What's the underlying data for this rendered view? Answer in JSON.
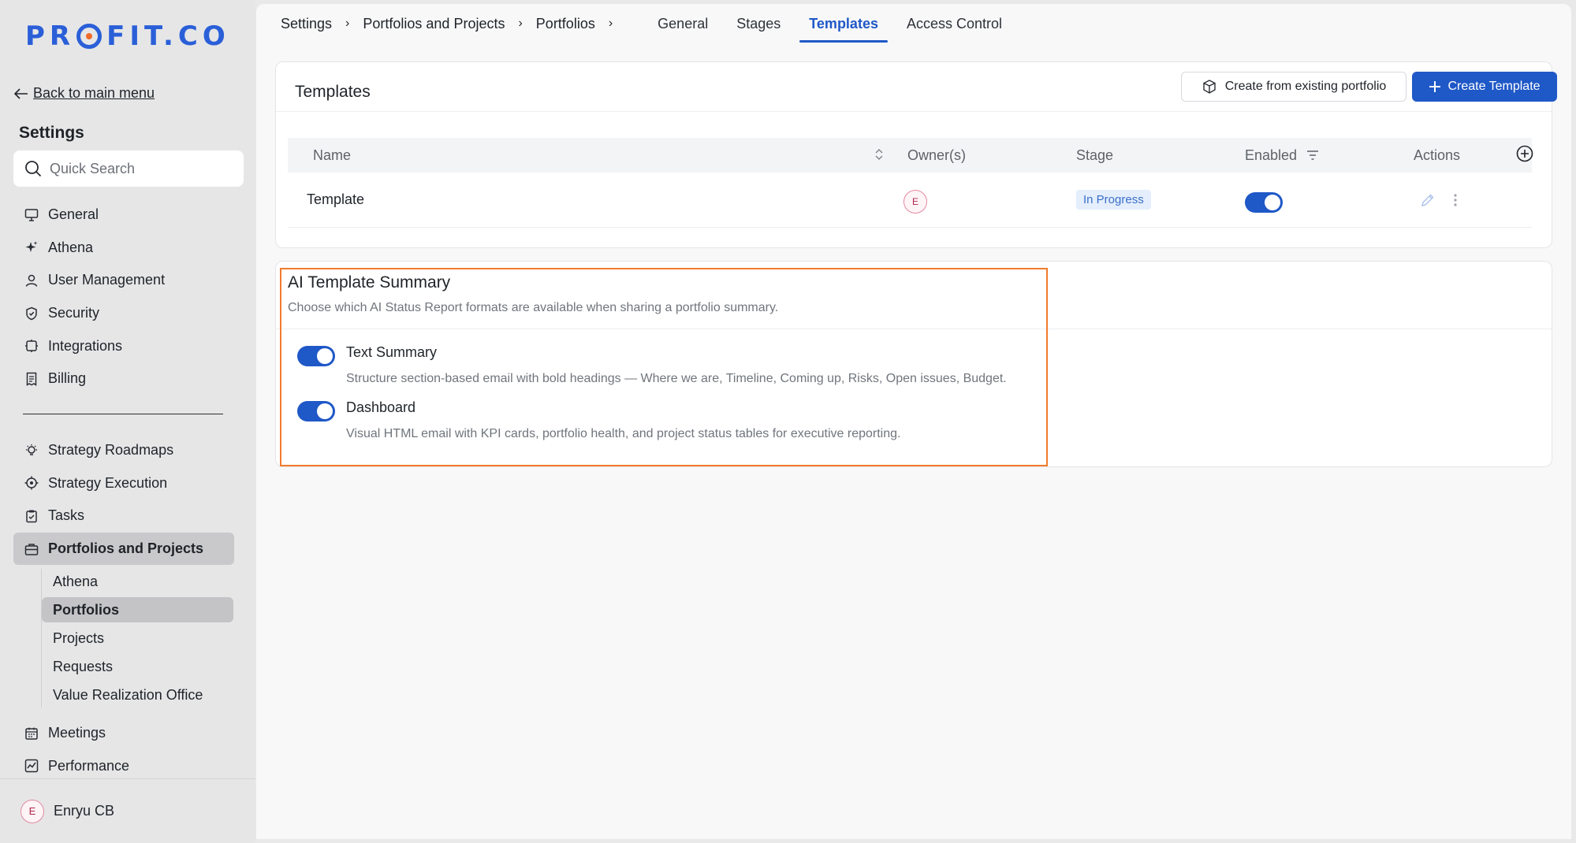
{
  "brand": {
    "logo_left": "PR",
    "logo_right": "FIT.CO"
  },
  "sidebar": {
    "back_label": "Back to main menu",
    "settings_title": "Settings",
    "search_placeholder": "Quick Search",
    "items_top": [
      {
        "label": "General",
        "icon": "monitor-icon"
      },
      {
        "label": "Athena",
        "icon": "sparkle-icon"
      },
      {
        "label": "User Management",
        "icon": "user-icon"
      },
      {
        "label": "Security",
        "icon": "shield-icon"
      },
      {
        "label": "Integrations",
        "icon": "puzzle-icon"
      },
      {
        "label": "Billing",
        "icon": "receipt-icon"
      }
    ],
    "items_modules": [
      {
        "label": "Strategy Roadmaps",
        "icon": "bulb-icon"
      },
      {
        "label": "Strategy Execution",
        "icon": "target-icon"
      },
      {
        "label": "Tasks",
        "icon": "clipboard-check-icon"
      },
      {
        "label": "Portfolios and Projects",
        "icon": "briefcase-icon"
      }
    ],
    "sub_items": [
      "Athena",
      "Portfolios",
      "Projects",
      "Requests",
      "Value Realization Office"
    ],
    "items_bottom": [
      {
        "label": "Meetings",
        "icon": "calendar-icon"
      },
      {
        "label": "Performance",
        "icon": "chart-icon"
      }
    ],
    "user": {
      "initial": "E",
      "name": "Enryu CB"
    }
  },
  "topbar": {
    "breadcrumbs": [
      "Settings",
      "Portfolios and Projects",
      "Portfolios"
    ],
    "tabs": [
      "General",
      "Stages",
      "Templates",
      "Access Control"
    ],
    "active_tab": "Templates"
  },
  "templates": {
    "title": "Templates",
    "create_existing_label": "Create from existing portfolio",
    "create_template_label": "Create Template",
    "columns": [
      "Name",
      "Owner(s)",
      "Stage",
      "Enabled",
      "Actions"
    ],
    "rows": [
      {
        "name": "Template",
        "owner_initial": "E",
        "stage": "In Progress",
        "enabled": true
      }
    ]
  },
  "ai_summary": {
    "title": "AI Template Summary",
    "subtitle": "Choose which AI Status Report formats are available when sharing a portfolio summary.",
    "options": [
      {
        "title": "Text Summary",
        "description": "Structure section-based email with bold headings — Where we are, Timeline, Coming up, Risks, Open issues, Budget.",
        "enabled": true
      },
      {
        "title": "Dashboard",
        "description": "Visual HTML email with KPI cards, portfolio health, and project status tables for executive reporting.",
        "enabled": true
      }
    ]
  },
  "colors": {
    "accent": "#1f58c7",
    "highlight": "#f27a2b",
    "logo_blue": "#2a5fd8",
    "logo_orange": "#f06a2a"
  }
}
